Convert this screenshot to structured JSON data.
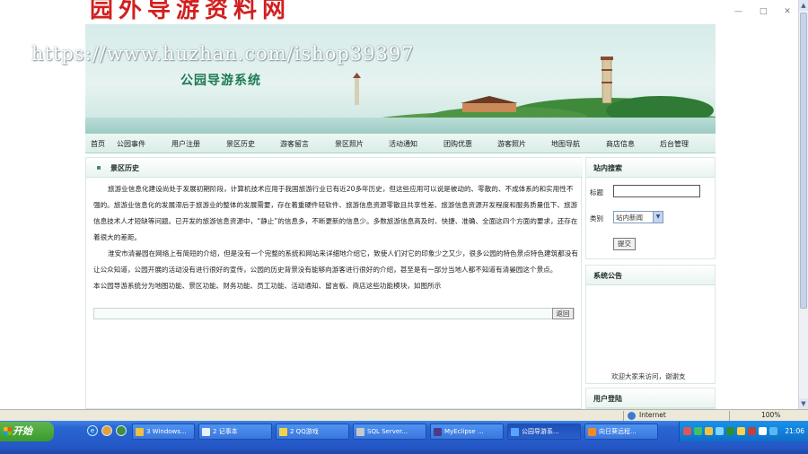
{
  "page": {
    "top_cut_text": "园外导游资料网",
    "watermark": "https://www.huzhan.com/ishop39397"
  },
  "banner": {
    "title": "公园导游系统"
  },
  "nav": {
    "items": [
      "首页",
      "公园事件",
      "用户注册",
      "景区历史",
      "游客留言",
      "景区照片",
      "活动通知",
      "团购优惠",
      "游客照片",
      "地图导航",
      "商店信息",
      "后台管理"
    ]
  },
  "main": {
    "heading": "景区历史",
    "paragraphs": [
      "旅游业信息化建设尚处于发展初期阶段，计算机技术应用于我国旅游行业已有近20多年历史，但这些应用可以说是被动的、零散的、不成体系的和实用性不强的。旅游业信息化的发展滞后于旅游业的整体的发展需要，存在着重硬件轻软件、旅游信息资源零散且共享性差、旅游信息资源开发程度和服务质量低下、旅游信息技术人才短缺等问题。已开发的旅游信息资源中，“静止”的信息多，不断更新的信息少。多数旅游信息高及时、快捷、准确、全面这四个方面的要求，还存在着很大的差距。",
      "淮安市清晏园在网络上有简短的介绍，但是没有一个完整的系统和网站来详细地介绍它，致使人们对它的印象少之又少，很多公园的特色景点特色建筑都没有让公众知道，公园开展的活动没有进行很好的宣传，公园的历史背景没有能够向游客进行很好的介绍，甚至是有一部分当地人都不知道有清晏园这个景点。",
      "本公园导游系统分为地图功能、景区功能、财务功能、员工功能、活动通知、留言板、商店这些功能模块，如图所示"
    ],
    "back_label": "返回"
  },
  "side": {
    "search": {
      "heading": "站内搜索",
      "title_label": "标题",
      "title_value": "",
      "category_label": "类别",
      "category_selected": "站内新闻",
      "submit_label": "提交"
    },
    "notice": {
      "heading": "系统公告",
      "scroll_text": "欢迎大家来访问，谢谢支"
    },
    "login": {
      "heading": "用户登陆"
    }
  },
  "status": {
    "zone": "Internet",
    "zoom": "100%"
  },
  "taskbar": {
    "start": "开始",
    "tasks": [
      "3 Windows...",
      "2 记事本",
      "2 QQ游戏",
      "SQL Server...",
      "MyEclipse ...",
      "公园导游系...",
      "向日葵远程..."
    ],
    "clock": "21:06"
  }
}
